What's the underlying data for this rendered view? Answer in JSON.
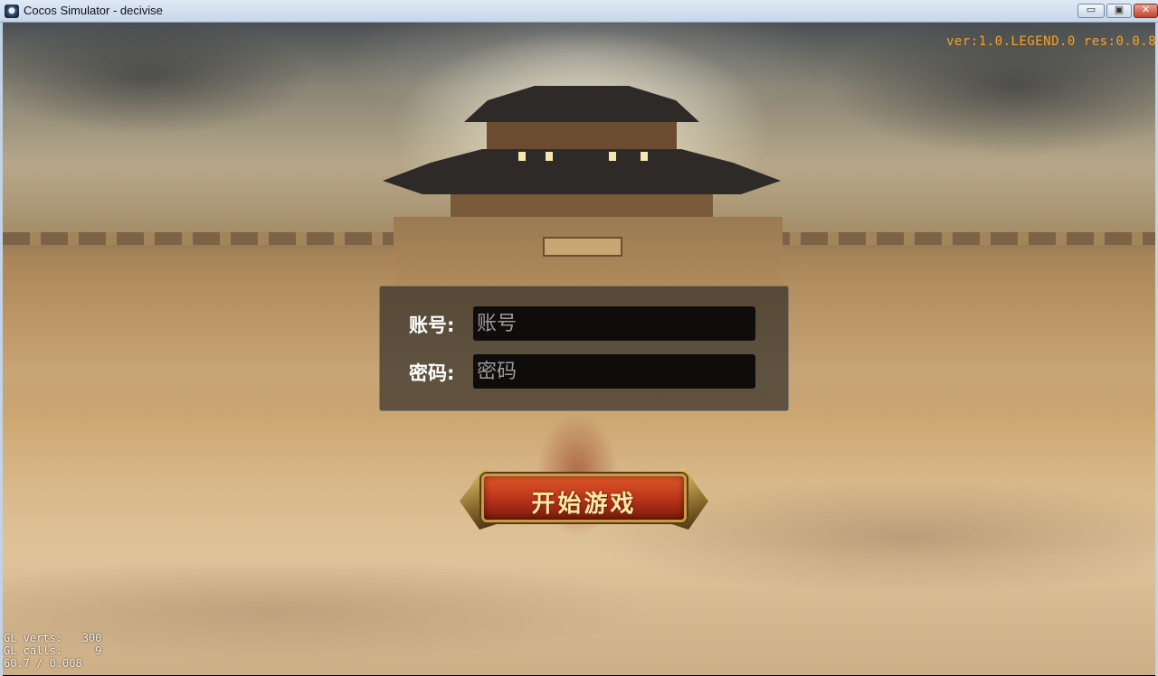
{
  "window": {
    "title": "Cocos Simulator - decivise",
    "minimize_glyph": "▭",
    "maximize_glyph": "▣",
    "close_glyph": "✕"
  },
  "game": {
    "version_text": "ver:1.0.LEGEND.0 res:0.0.8",
    "login": {
      "account_label": "账号:",
      "account_placeholder": "账号",
      "account_value": "",
      "password_label": "密码:",
      "password_placeholder": "密码",
      "password_value": ""
    },
    "start_button_label": "开始游戏",
    "stats": {
      "line1": "GL verts:   300",
      "line2": "GL calls:     9",
      "line3": "60.7 / 0.008"
    }
  },
  "colors": {
    "version": "#f3a326",
    "start_button": "#b8321a",
    "panel": "rgba(30,30,30,0.62)"
  }
}
